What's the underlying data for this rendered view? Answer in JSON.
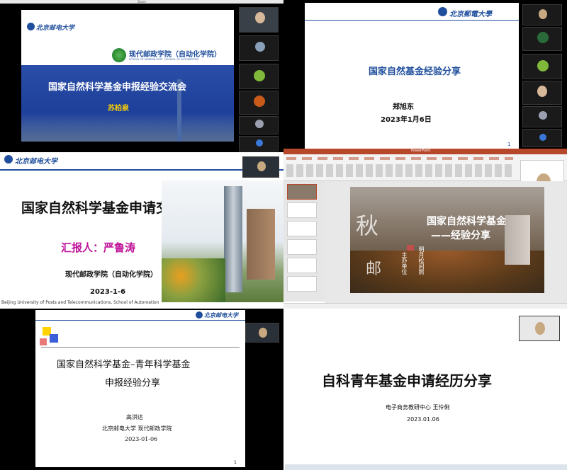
{
  "q1": {
    "window_title": "Zoom",
    "university_logo": "北京邮电大学",
    "school_name_cn": "现代邮政学院（自动化学院）",
    "school_name_en": "SCHOOL OF MODERN POST（SCHOOL OF AUTOMATION）",
    "title": "国家自然科学基金申报经验交流会",
    "presenter": "苏柏泉"
  },
  "q2": {
    "university_logo": "北京郵電大學",
    "title": "国家自然基金经验分享",
    "presenter": "郑旭东",
    "date": "2023年1月6日",
    "page_number": "1"
  },
  "q3": {
    "university_logo": "北京邮电大学",
    "title": "国家自然科学基金申请交流",
    "presenter": "汇报人：严鲁涛",
    "school": "现代邮政学院（自动化学院）",
    "date": "2023-1-6",
    "footer": "Beijing University of Posts and Telecommunications, School of Automation"
  },
  "q4": {
    "window_title": "PowerPoint",
    "slide_title_line1": "国家自然科学基金",
    "slide_title_line2": "——经验分享",
    "calligraphy_1": "秋",
    "calligraphy_2": "邮",
    "verse_1": "主办单位",
    "verse_2": "明月松间照"
  },
  "q5": {
    "university_logo": "北京邮电大学",
    "title_line1": "国家自然科学基金–青年科学基金",
    "title_line2": "申报经验分享",
    "presenter": "高洪达",
    "affiliation": "北京邮电大学 现代邮政学院",
    "date": "2023-01-06",
    "page_number": "1"
  },
  "q6": {
    "title": "自科青年基金申请经历分享",
    "affiliation": "电子商务教研中心  王伶俐",
    "date": "2023.01.06"
  },
  "colors": {
    "q1_blue": "#2a4fa8",
    "q1_title_bg": "#1e3f9a",
    "title_blue": "#1f4e9c",
    "presenter_magenta": "#c0149a",
    "presenter_yellow": "#ffd200",
    "q4_accent": "#c0504d"
  }
}
